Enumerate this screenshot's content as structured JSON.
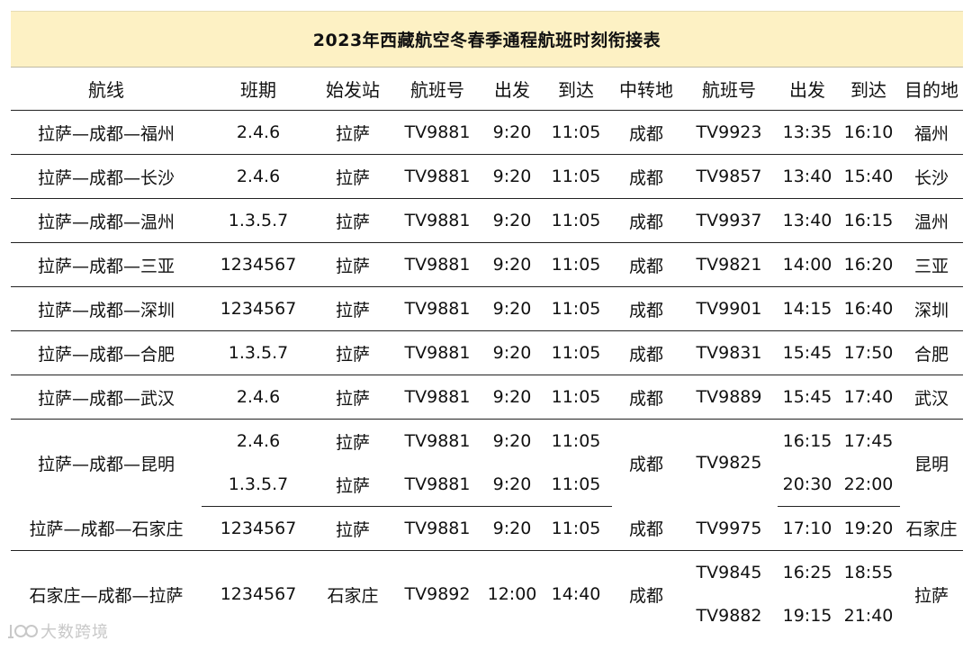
{
  "title": "2023年西藏航空冬春季通程航班时刻衔接表",
  "headers": [
    "航线",
    "班期",
    "始发站",
    "航班号",
    "出发",
    "到达",
    "中转地",
    "航班号",
    "出发",
    "到达",
    "目的地"
  ],
  "rows": [
    {
      "route": "拉萨—成都—福州",
      "days": "2.4.6",
      "origin": "拉萨",
      "flight1": "TV9881",
      "dep1": "9:20",
      "arr1": "11:05",
      "transfer": "成都",
      "flight2": "TV9923",
      "dep2": "13:35",
      "arr2": "16:10",
      "dest": "福州"
    },
    {
      "route": "拉萨—成都—长沙",
      "days": "2.4.6",
      "origin": "拉萨",
      "flight1": "TV9881",
      "dep1": "9:20",
      "arr1": "11:05",
      "transfer": "成都",
      "flight2": "TV9857",
      "dep2": "13:40",
      "arr2": "15:40",
      "dest": "长沙"
    },
    {
      "route": "拉萨—成都—温州",
      "days": "1.3.5.7",
      "origin": "拉萨",
      "flight1": "TV9881",
      "dep1": "9:20",
      "arr1": "11:05",
      "transfer": "成都",
      "flight2": "TV9937",
      "dep2": "13:40",
      "arr2": "16:15",
      "dest": "温州"
    },
    {
      "route": "拉萨—成都—三亚",
      "days": "1234567",
      "origin": "拉萨",
      "flight1": "TV9881",
      "dep1": "9:20",
      "arr1": "11:05",
      "transfer": "成都",
      "flight2": "TV9821",
      "dep2": "14:00",
      "arr2": "16:20",
      "dest": "三亚"
    },
    {
      "route": "拉萨—成都—深圳",
      "days": "1234567",
      "origin": "拉萨",
      "flight1": "TV9881",
      "dep1": "9:20",
      "arr1": "11:05",
      "transfer": "成都",
      "flight2": "TV9901",
      "dep2": "14:15",
      "arr2": "16:40",
      "dest": "深圳"
    },
    {
      "route": "拉萨—成都—合肥",
      "days": "1.3.5.7",
      "origin": "拉萨",
      "flight1": "TV9881",
      "dep1": "9:20",
      "arr1": "11:05",
      "transfer": "成都",
      "flight2": "TV9831",
      "dep2": "15:45",
      "arr2": "17:50",
      "dest": "合肥"
    },
    {
      "route": "拉萨—成都—武汉",
      "days": "2.4.6",
      "origin": "拉萨",
      "flight1": "TV9881",
      "dep1": "9:20",
      "arr1": "11:05",
      "transfer": "成都",
      "flight2": "TV9889",
      "dep2": "15:45",
      "arr2": "17:40",
      "dest": "武汉"
    }
  ],
  "kunming": {
    "route": "拉萨—成都—昆明",
    "transfer": "成都",
    "flight2": "TV9825",
    "dest": "昆明",
    "sub": [
      {
        "days": "2.4.6",
        "origin": "拉萨",
        "flight1": "TV9881",
        "dep1": "9:20",
        "arr1": "11:05",
        "dep2": "16:15",
        "arr2": "17:45"
      },
      {
        "days": "1.3.5.7",
        "origin": "拉萨",
        "flight1": "TV9881",
        "dep1": "9:20",
        "arr1": "11:05",
        "dep2": "20:30",
        "arr2": "22:00"
      }
    ]
  },
  "shijiazhuang": {
    "route": "拉萨—成都—石家庄",
    "days": "1234567",
    "origin": "拉萨",
    "flight1": "TV9881",
    "dep1": "9:20",
    "arr1": "11:05",
    "transfer": "成都",
    "flight2": "TV9975",
    "dep2": "17:10",
    "arr2": "19:20",
    "dest": "石家庄"
  },
  "to_lhasa": {
    "route": "石家庄—成都—拉萨",
    "days": "1234567",
    "origin": "石家庄",
    "flight1": "TV9892",
    "dep1": "12:00",
    "arr1": "14:40",
    "transfer": "成都",
    "dest": "拉萨",
    "sub": [
      {
        "flight2": "TV9845",
        "dep2": "16:25",
        "arr2": "18:55"
      },
      {
        "flight2": "TV9882",
        "dep2": "19:15",
        "arr2": "21:40"
      }
    ]
  },
  "watermark": {
    "text": "大数跨境",
    "icon": "dashuju-logo-icon"
  }
}
